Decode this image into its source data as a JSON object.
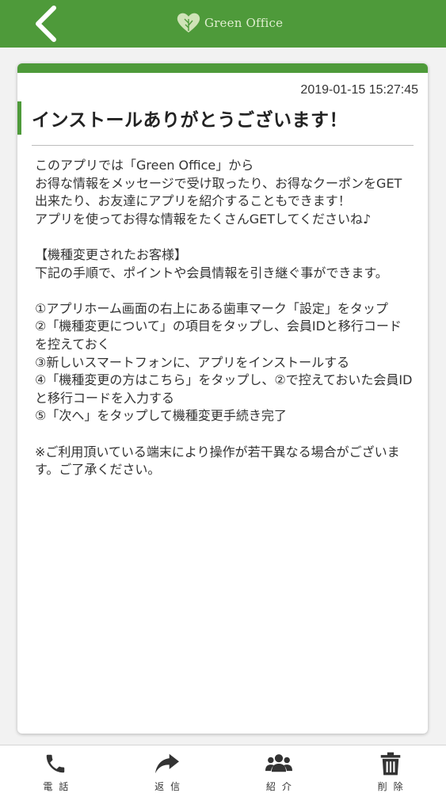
{
  "header": {
    "logo_text": "Green Office",
    "back_icon": "chevron-left-icon",
    "background_color": "#4e9a3a"
  },
  "message": {
    "timestamp": "2019-01-15 15:27:45",
    "title": "インストールありがとうございます！",
    "paragraphs": [
      "このアプリでは「Green Office」から\nお得な情報をメッセージで受け取ったり、お得なクーポンをGET出来たり、お友達にアプリを紹介することもできます！\nアプリを使ってお得な情報をたくさんGETしてくださいね♪",
      "【機種変更されたお客様】\n下記の手順で、ポイントや会員情報を引き継ぐ事ができます。",
      "①アプリホーム画面の右上にある歯車マーク「設定」をタップ\n②「機種変更について」の項目をタップし、会員IDと移行コードを控えておく\n③新しいスマートフォンに、アプリをインストールする\n④「機種変更の方はこちら」をタップし、②で控えておいた会員IDと移行コードを入力する\n⑤「次へ」をタップして機種変更手続き完了",
      "※ご利用頂いている端末により操作が若干異なる場合がございます。ご了承ください。"
    ]
  },
  "bottom_nav": {
    "items": [
      {
        "label": "電話",
        "icon": "phone-icon"
      },
      {
        "label": "返信",
        "icon": "reply-icon"
      },
      {
        "label": "紹介",
        "icon": "users-icon"
      },
      {
        "label": "削除",
        "icon": "trash-icon"
      }
    ]
  }
}
